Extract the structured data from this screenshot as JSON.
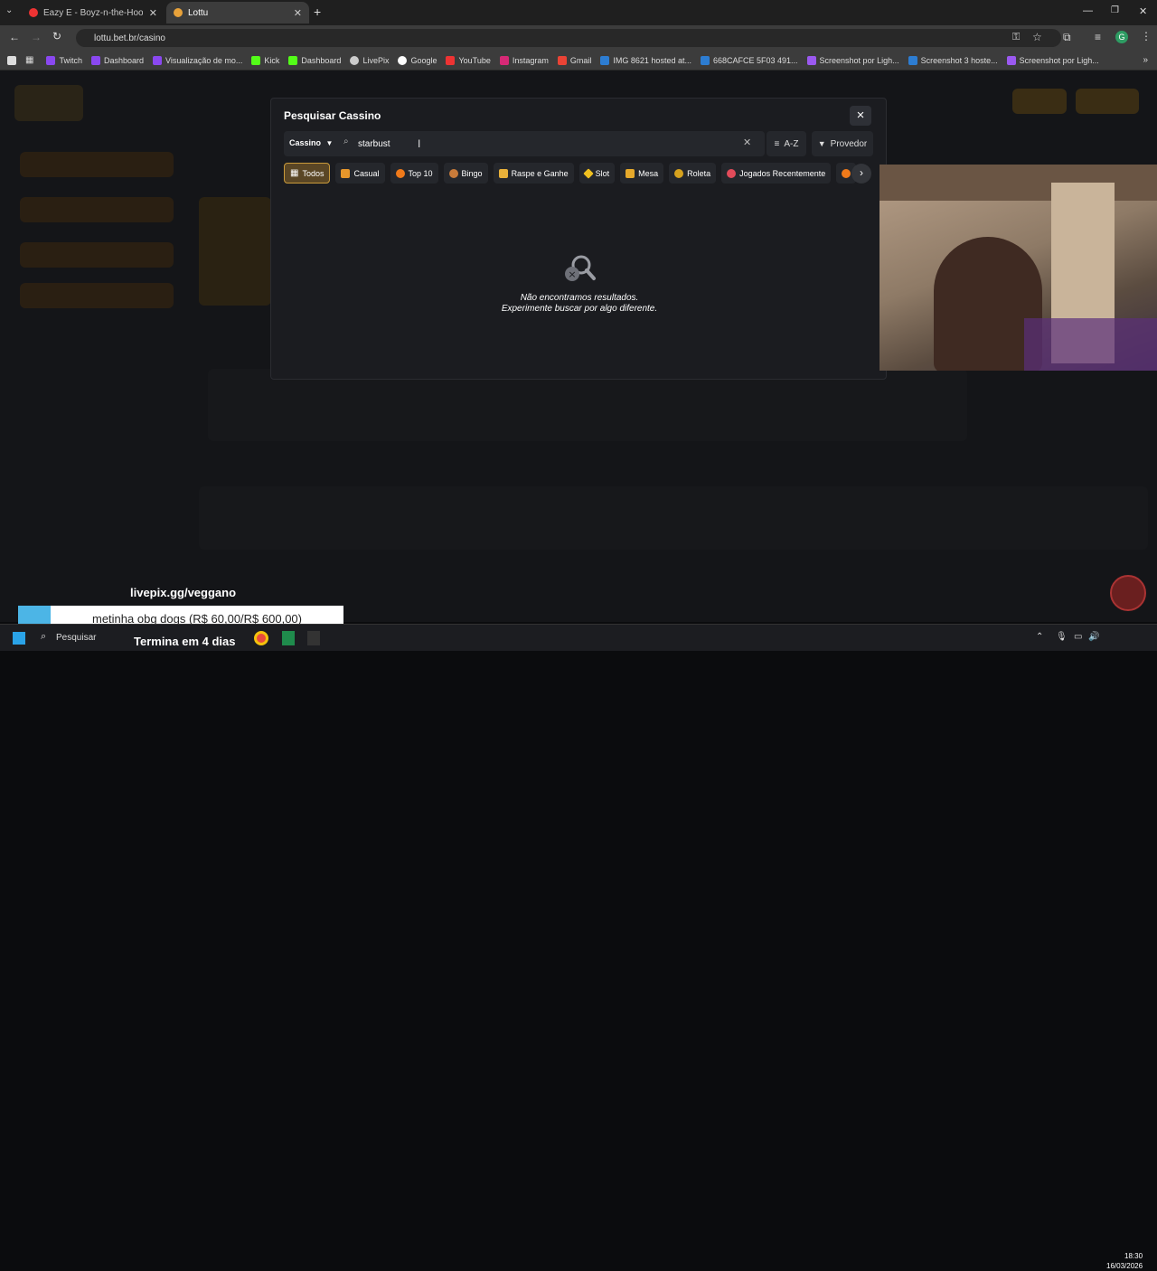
{
  "browser": {
    "tabs": [
      {
        "title": "Eazy E - Boyz-n-the-Hood (Mu",
        "active": false
      },
      {
        "title": "Lottu",
        "active": true
      }
    ],
    "url": "lottu.bet.br/casino",
    "bookmarks": [
      "Twitch",
      "Dashboard",
      "Visualização de mo...",
      "Kick",
      "Dashboard",
      "LivePix",
      "Google",
      "YouTube",
      "Instagram",
      "Gmail",
      "IMG 8621 hosted at...",
      "668CAFCE 5F03 491...",
      "Screenshot por Ligh...",
      "Screenshot 3 hoste...",
      "Screenshot por Ligh..."
    ],
    "profile_initial": "G"
  },
  "modal": {
    "title": "Pesquisar Cassino",
    "category_select": "Cassino",
    "search_value": "starbust",
    "sort_label": "A-Z",
    "provider_label": "Provedor",
    "chips": [
      "Todos",
      "Casual",
      "Top 10",
      "Bingo",
      "Raspe e Ganhe",
      "Slot",
      "Mesa",
      "Roleta",
      "Jogados Recentemente"
    ],
    "empty_line1": "Não encontramos resultados.",
    "empty_line2": "Experimente buscar por algo diferente."
  },
  "overlay": {
    "livepix_handle": "livepix.gg/veggano",
    "donation_text": "metinha obg dogs (R$ 60,00/R$ 600,00)",
    "banner_text": "Termina em 4 dias"
  },
  "taskbar": {
    "search_label": "Pesquisar",
    "time": "18:30",
    "date": "16/03/2026"
  },
  "colors": {
    "accent": "#c99a3a",
    "modal_bg": "#1b1c20"
  }
}
